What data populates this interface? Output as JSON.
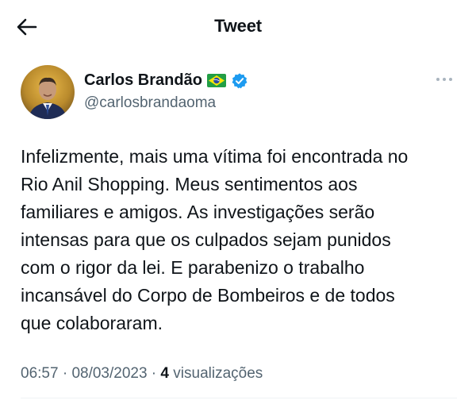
{
  "header": {
    "title": "Tweet",
    "back_icon": "arrow-left-icon"
  },
  "author": {
    "name": "Carlos Brandão",
    "flag_icon": "brazil-flag-icon",
    "verified_icon": "verified-badge-icon",
    "handle": "@carlosbrandaoma",
    "more_icon": "more-options-icon"
  },
  "tweet": {
    "text": "Infelizmente, mais uma vítima foi encontrada no\nRio Anil Shopping. Meus sentimentos aos\nfamiliares e amigos. As investigações serão\nintensas para que os culpados sejam punidos\ncom o rigor da lei. E parabenizo o trabalho\nincansável do Corpo de Bombeiros e de todos\nque colaboraram.",
    "time": "06:57",
    "date": "08/03/2023",
    "views_count": "4",
    "views_label": "visualizações"
  },
  "colors": {
    "text": "#0f1419",
    "secondary": "#536471",
    "verified": "#1d9bf0"
  }
}
